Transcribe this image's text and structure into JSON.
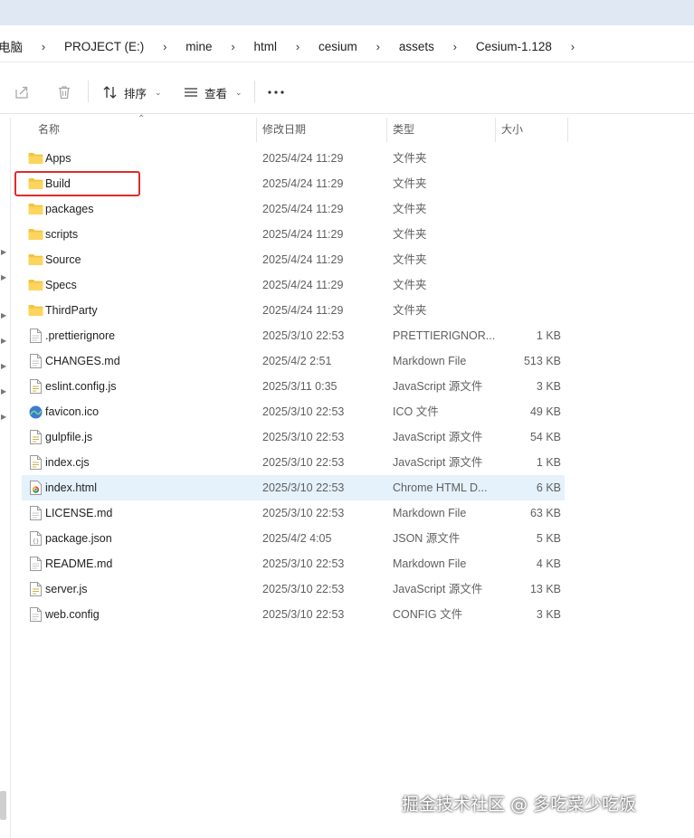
{
  "breadcrumb": [
    {
      "label": "电脑"
    },
    {
      "label": "PROJECT (E:)"
    },
    {
      "label": "mine"
    },
    {
      "label": "html"
    },
    {
      "label": "cesium"
    },
    {
      "label": "assets"
    },
    {
      "label": "Cesium-1.128"
    }
  ],
  "toolbar": {
    "share_icon": "share-icon",
    "delete_icon": "trash-icon",
    "sort_label": "排序",
    "view_label": "查看",
    "more_icon": "more-icon"
  },
  "columns": {
    "name": "名称",
    "date": "修改日期",
    "type": "类型",
    "size": "大小"
  },
  "files": [
    {
      "name": "Apps",
      "date": "2025/4/24 11:29",
      "type": "文件夹",
      "size": "",
      "icon": "folder-icon"
    },
    {
      "name": "Build",
      "date": "2025/4/24 11:29",
      "type": "文件夹",
      "size": "",
      "icon": "folder-icon"
    },
    {
      "name": "packages",
      "date": "2025/4/24 11:29",
      "type": "文件夹",
      "size": "",
      "icon": "folder-icon"
    },
    {
      "name": "scripts",
      "date": "2025/4/24 11:29",
      "type": "文件夹",
      "size": "",
      "icon": "folder-icon"
    },
    {
      "name": "Source",
      "date": "2025/4/24 11:29",
      "type": "文件夹",
      "size": "",
      "icon": "folder-icon"
    },
    {
      "name": "Specs",
      "date": "2025/4/24 11:29",
      "type": "文件夹",
      "size": "",
      "icon": "folder-icon"
    },
    {
      "name": "ThirdParty",
      "date": "2025/4/24 11:29",
      "type": "文件夹",
      "size": "",
      "icon": "folder-icon"
    },
    {
      "name": ".prettierignore",
      "date": "2025/3/10 22:53",
      "type": "PRETTIERIGNOR...",
      "size": "1 KB",
      "icon": "file-icon"
    },
    {
      "name": "CHANGES.md",
      "date": "2025/4/2 2:51",
      "type": "Markdown File",
      "size": "513 KB",
      "icon": "file-icon"
    },
    {
      "name": "eslint.config.js",
      "date": "2025/3/11 0:35",
      "type": "JavaScript 源文件",
      "size": "3 KB",
      "icon": "js-file-icon"
    },
    {
      "name": "favicon.ico",
      "date": "2025/3/10 22:53",
      "type": "ICO 文件",
      "size": "49 KB",
      "icon": "ico-file-icon"
    },
    {
      "name": "gulpfile.js",
      "date": "2025/3/10 22:53",
      "type": "JavaScript 源文件",
      "size": "54 KB",
      "icon": "js-file-icon"
    },
    {
      "name": "index.cjs",
      "date": "2025/3/10 22:53",
      "type": "JavaScript 源文件",
      "size": "1 KB",
      "icon": "js-file-icon"
    },
    {
      "name": "index.html",
      "date": "2025/3/10 22:53",
      "type": "Chrome HTML D...",
      "size": "6 KB",
      "icon": "chrome-file-icon"
    },
    {
      "name": "LICENSE.md",
      "date": "2025/3/10 22:53",
      "type": "Markdown File",
      "size": "63 KB",
      "icon": "file-icon"
    },
    {
      "name": "package.json",
      "date": "2025/4/2 4:05",
      "type": "JSON 源文件",
      "size": "5 KB",
      "icon": "json-file-icon"
    },
    {
      "name": "README.md",
      "date": "2025/3/10 22:53",
      "type": "Markdown File",
      "size": "4 KB",
      "icon": "file-icon"
    },
    {
      "name": "server.js",
      "date": "2025/3/10 22:53",
      "type": "JavaScript 源文件",
      "size": "13 KB",
      "icon": "js-file-icon"
    },
    {
      "name": "web.config",
      "date": "2025/3/10 22:53",
      "type": "CONFIG 文件",
      "size": "3 KB",
      "icon": "file-icon"
    }
  ],
  "selected_file": "index.html",
  "highlighted_file": "Build",
  "colors": {
    "folder": "#f5c33b",
    "selection": "#e5f1fb",
    "highlight_box": "#e02b2b",
    "titlebar": "#dfe8f3"
  },
  "watermark": "掘金技术社区 @ 多吃菜少吃饭"
}
